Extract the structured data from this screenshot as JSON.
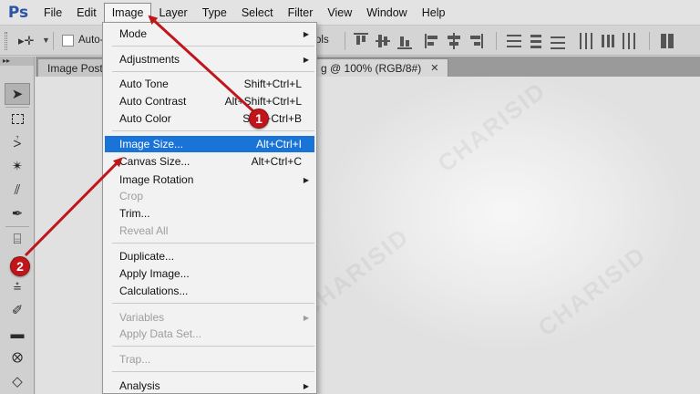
{
  "app": {
    "logo": "Ps"
  },
  "menubar": {
    "items": [
      "File",
      "Edit",
      "Image",
      "Layer",
      "Type",
      "Select",
      "Filter",
      "View",
      "Window",
      "Help"
    ],
    "active": "Image"
  },
  "options": {
    "auto_label": "Auto-",
    "partial_label": "ols"
  },
  "tabs": [
    {
      "label": "Image Post..."
    },
    {
      "label": "g @ 100% (RGB/8#)"
    }
  ],
  "image_menu": {
    "mode": "Mode",
    "adjustments": "Adjustments",
    "auto_tone": {
      "label": "Auto Tone",
      "shortcut": "Shift+Ctrl+L"
    },
    "auto_contrast": {
      "label": "Auto Contrast",
      "shortcut": "Alt+Shift+Ctrl+L"
    },
    "auto_color": {
      "label": "Auto Color",
      "shortcut": "Shift+Ctrl+B"
    },
    "image_size": {
      "label": "Image Size...",
      "shortcut": "Alt+Ctrl+I"
    },
    "canvas_size": {
      "label": "Canvas Size...",
      "shortcut": "Alt+Ctrl+C"
    },
    "image_rotation": "Image Rotation",
    "crop": "Crop",
    "trim": "Trim...",
    "reveal_all": "Reveal All",
    "duplicate": "Duplicate...",
    "apply_image": "Apply Image...",
    "calculations": "Calculations...",
    "variables": "Variables",
    "apply_data_set": "Apply Data Set...",
    "trap": "Trap...",
    "analysis": "Analysis"
  },
  "annotations": {
    "step1": "1",
    "step2": "2",
    "color": "#c0161b"
  },
  "colors": {
    "highlight": "#1a73d6",
    "accent_red": "#c0161b"
  }
}
